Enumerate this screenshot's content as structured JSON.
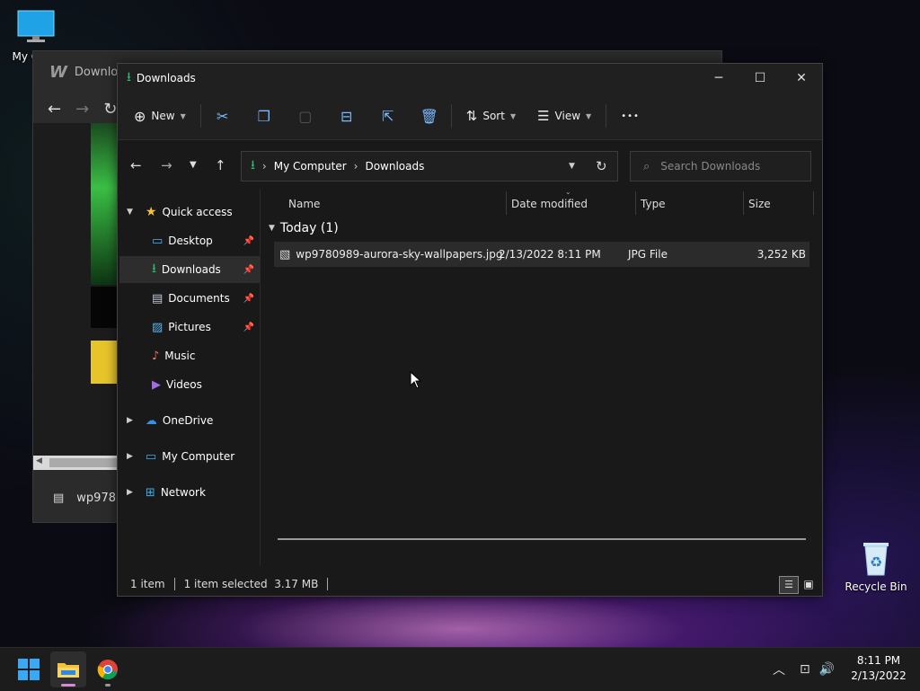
{
  "desktop": {
    "my_computer_label": "My Co",
    "recycle_bin_label": "Recycle Bin"
  },
  "bg_window": {
    "title": "Downloa",
    "download_item": "wp9780"
  },
  "explorer": {
    "title": "Downloads",
    "toolbar": {
      "new_label": "New",
      "sort_label": "Sort",
      "view_label": "View",
      "more_label": "•••"
    },
    "breadcrumb": [
      "My Computer",
      "Downloads"
    ],
    "search_placeholder": "Search Downloads",
    "nav": {
      "quick_access": "Quick access",
      "desktop": "Desktop",
      "downloads": "Downloads",
      "documents": "Documents",
      "pictures": "Pictures",
      "music": "Music",
      "videos": "Videos",
      "onedrive": "OneDrive",
      "my_computer": "My Computer",
      "network": "Network"
    },
    "columns": {
      "name": "Name",
      "date": "Date modified",
      "type": "Type",
      "size": "Size"
    },
    "group_label": "Today (1)",
    "file": {
      "name": "wp9780989-aurora-sky-wallpapers.jpg",
      "date": "2/13/2022 8:11 PM",
      "type": "JPG File",
      "size": "3,252 KB"
    },
    "status": {
      "count": "1 item",
      "selected": "1 item selected  3.17 MB"
    }
  },
  "taskbar": {
    "time": "8:11 PM",
    "date": "2/13/2022"
  },
  "colors": {
    "accent_green": "#2fbf71",
    "accent_blue": "#7ab9ff",
    "selection": "#2d2d2d"
  }
}
